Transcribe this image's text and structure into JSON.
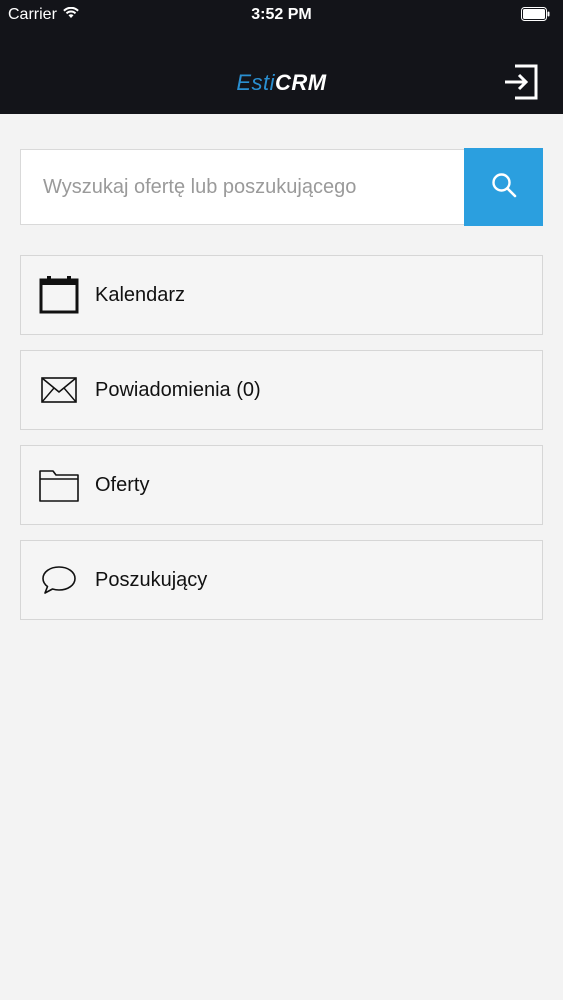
{
  "status_bar": {
    "carrier": "Carrier",
    "time": "3:52 PM"
  },
  "header": {
    "logo_part1": "Esti",
    "logo_part2": "CRM",
    "logout_icon": "logout-icon"
  },
  "search": {
    "placeholder": "Wyszukaj ofertę lub poszukującego",
    "value": "",
    "button_icon": "search-icon",
    "accent_color": "#2b9fdf"
  },
  "menu": {
    "items": [
      {
        "label": "Kalendarz",
        "icon": "calendar-icon"
      },
      {
        "label": "Powiadomienia (0)",
        "icon": "envelope-icon"
      },
      {
        "label": "Oferty",
        "icon": "folder-icon"
      },
      {
        "label": "Poszukujący",
        "icon": "chat-bubble-icon"
      }
    ]
  },
  "colors": {
    "header_bg": "#131419",
    "logo_accent": "#2a8fd0",
    "page_bg": "#f3f3f3"
  }
}
